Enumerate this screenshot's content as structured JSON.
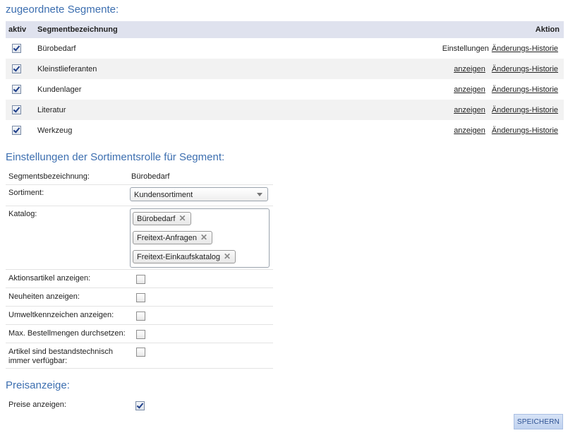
{
  "segments_section": {
    "title": "zugeordnete Segmente:",
    "header": {
      "aktiv": "aktiv",
      "name": "Segmentbezeichnung",
      "action": "Aktion"
    },
    "rows": [
      {
        "name": "Bürobedarf",
        "active": true,
        "action1": "Einstellungen",
        "action1_is_link": false,
        "action2": "Änderungs-Historie"
      },
      {
        "name": "Kleinstlieferanten",
        "active": true,
        "action1": "anzeigen",
        "action1_is_link": true,
        "action2": "Änderungs-Historie"
      },
      {
        "name": "Kundenlager",
        "active": true,
        "action1": "anzeigen",
        "action1_is_link": true,
        "action2": "Änderungs-Historie"
      },
      {
        "name": "Literatur",
        "active": true,
        "action1": "anzeigen",
        "action1_is_link": true,
        "action2": "Änderungs-Historie"
      },
      {
        "name": "Werkzeug",
        "active": true,
        "action1": "anzeigen",
        "action1_is_link": true,
        "action2": "Änderungs-Historie"
      }
    ]
  },
  "settings_section": {
    "title": "Einstellungen der Sortimentsrolle für Segment:",
    "segment_label": "Segmentsbezeichnung:",
    "segment_value": "Bürobedarf",
    "sortiment_label": "Sortiment:",
    "sortiment_value": "Kundensortiment",
    "katalog_label": "Katalog:",
    "katalog_tags": [
      "Bürobedarf",
      "Freitext-Anfragen",
      "Freitext-Einkaufskatalog"
    ],
    "options": [
      {
        "label": "Aktionsartikel anzeigen:",
        "checked": false
      },
      {
        "label": "Neuheiten anzeigen:",
        "checked": false
      },
      {
        "label": "Umweltkennzeichen anzeigen:",
        "checked": false
      },
      {
        "label": "Max. Bestellmengen durchsetzen:",
        "checked": false
      },
      {
        "label": "Artikel sind bestandstechnisch immer verfügbar:",
        "checked": false
      }
    ]
  },
  "price_section": {
    "title": "Preisanzeige:",
    "show_prices_label": "Preise anzeigen:",
    "show_prices_checked": true
  },
  "save_label": "SPEICHERN"
}
